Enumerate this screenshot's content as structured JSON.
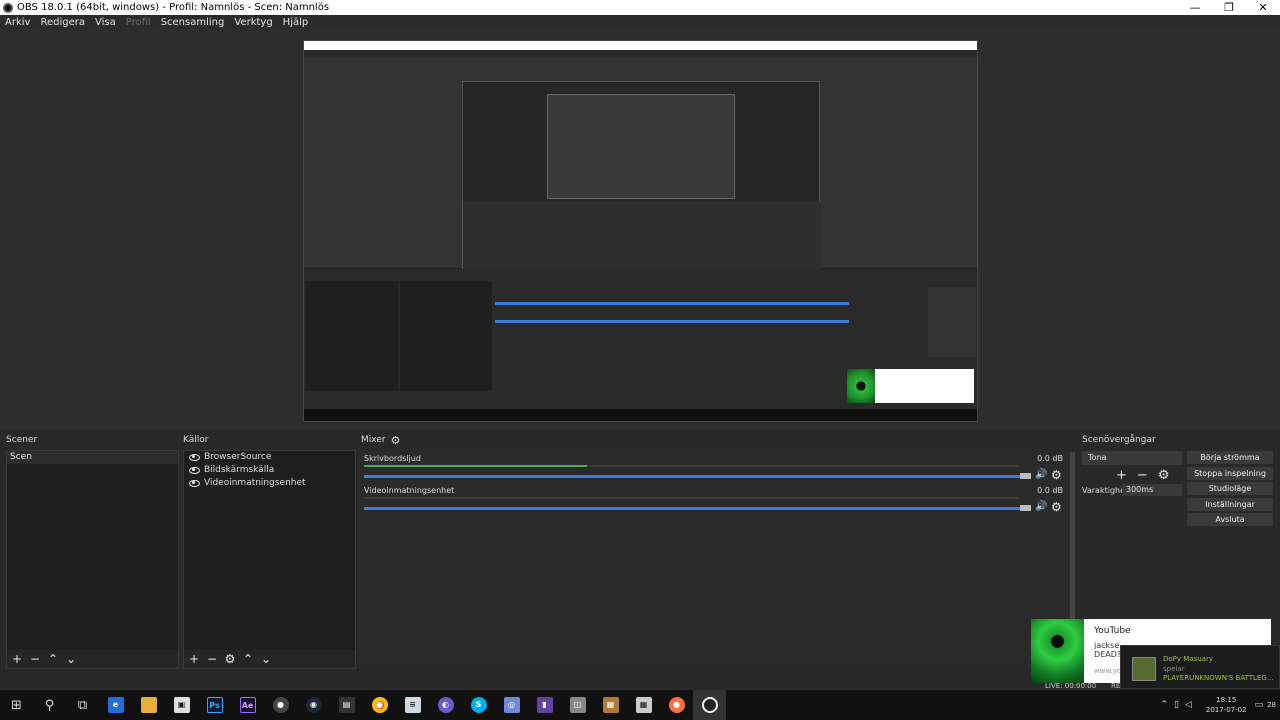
{
  "window": {
    "title": "OBS 18.0.1 (64bit, windows) - Profil: Namnlös - Scen: Namnlös",
    "minimize": "—",
    "maximize": "❐",
    "close": "✕"
  },
  "menu": [
    "Arkiv",
    "Redigera",
    "Visa",
    "Profil",
    "Scensamling",
    "Verktyg",
    "Hjälp"
  ],
  "docks": {
    "scenes_title": "Scener",
    "sources_title": "Källor",
    "mixer_title": "Mixer",
    "transitions_title": "Scenövergångar"
  },
  "scenes": [
    "Scen"
  ],
  "sources": [
    "BrowserSource",
    "Bildskärmskälla",
    "Videoinmatningsenhet"
  ],
  "mixer": {
    "tracks": [
      {
        "name": "Skrivbordsljud",
        "db": "0.0 dB",
        "level": 0.34
      },
      {
        "name": "Videoinmatningsenhet",
        "db": "0.0 dB",
        "level": 0
      }
    ]
  },
  "transitions": {
    "selected": "Tona",
    "duration_label": "Varaktighet",
    "duration": "300ms"
  },
  "controls": [
    "Börja strömma",
    "Stoppa inspelning",
    "Studioläge",
    "Inställningar",
    "Avsluta"
  ],
  "toast": {
    "title": "YouTube",
    "line1": "jackse",
    "line2": "DEAD?",
    "line3": "www.yo"
  },
  "steam_toast": {
    "name": "DoPy Masuary",
    "status": "spelar",
    "game": "PLAYERUNKNOWN'S BATTLEG..."
  },
  "status": {
    "live": "LIVE: 00:00:00",
    "rec": "RE"
  },
  "tray": {
    "time": "18:15",
    "date": "2017-07-02",
    "notif": "28"
  }
}
